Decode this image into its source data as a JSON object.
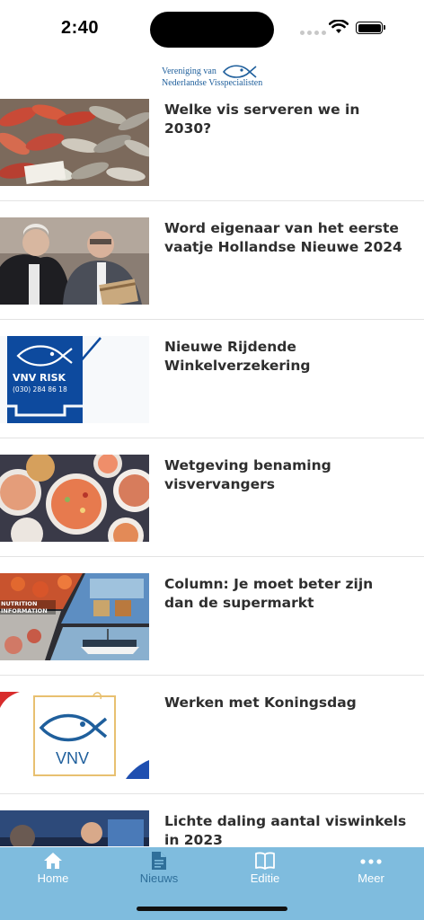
{
  "status_bar": {
    "time": "2:40"
  },
  "header": {
    "logo_line1": "Vereniging van",
    "logo_line2": "Nederlandse Visspecialisten"
  },
  "news": [
    {
      "title": "Welke vis serveren we in 2030?",
      "image": "fish-market-photo"
    },
    {
      "title": "Word eigenaar van het eerste vaatje Hollandse Nieuwe 2024",
      "image": "two-men-with-barrel-photo"
    },
    {
      "title": "Nieuwe Rijdende Winkelverzekering",
      "image": "vnv-risk-logo"
    },
    {
      "title": "Wetgeving benaming visvervangers",
      "image": "seafood-dishes-photo"
    },
    {
      "title": "Column: Je moet beter zijn dan de supermarkt",
      "image": "seafood-collage-photo"
    },
    {
      "title": "Werken met Koningsdag",
      "image": "vnv-logo"
    },
    {
      "title": "Lichte daling aantal viswinkels in 2023",
      "image": "tv-studio-photo"
    }
  ],
  "vnv_risk": {
    "name": "VNV RISK",
    "phone": "(030) 284 86 18"
  },
  "vnv_logo_text": "VNV",
  "collage_text_1": "NUTRITION",
  "collage_text_2": "INFORMATION",
  "tabs": [
    {
      "label": "Home",
      "icon": "home-icon",
      "state": "active"
    },
    {
      "label": "Nieuws",
      "icon": "document-icon",
      "state": "inactive"
    },
    {
      "label": "Editie",
      "icon": "book-icon",
      "state": "active"
    },
    {
      "label": "Meer",
      "icon": "more-icon",
      "state": "active"
    }
  ],
  "colors": {
    "tab_bar": "#7fbcde",
    "brand_blue": "#1f5f9c",
    "vnv_risk_blue": "#0d4a9e"
  }
}
